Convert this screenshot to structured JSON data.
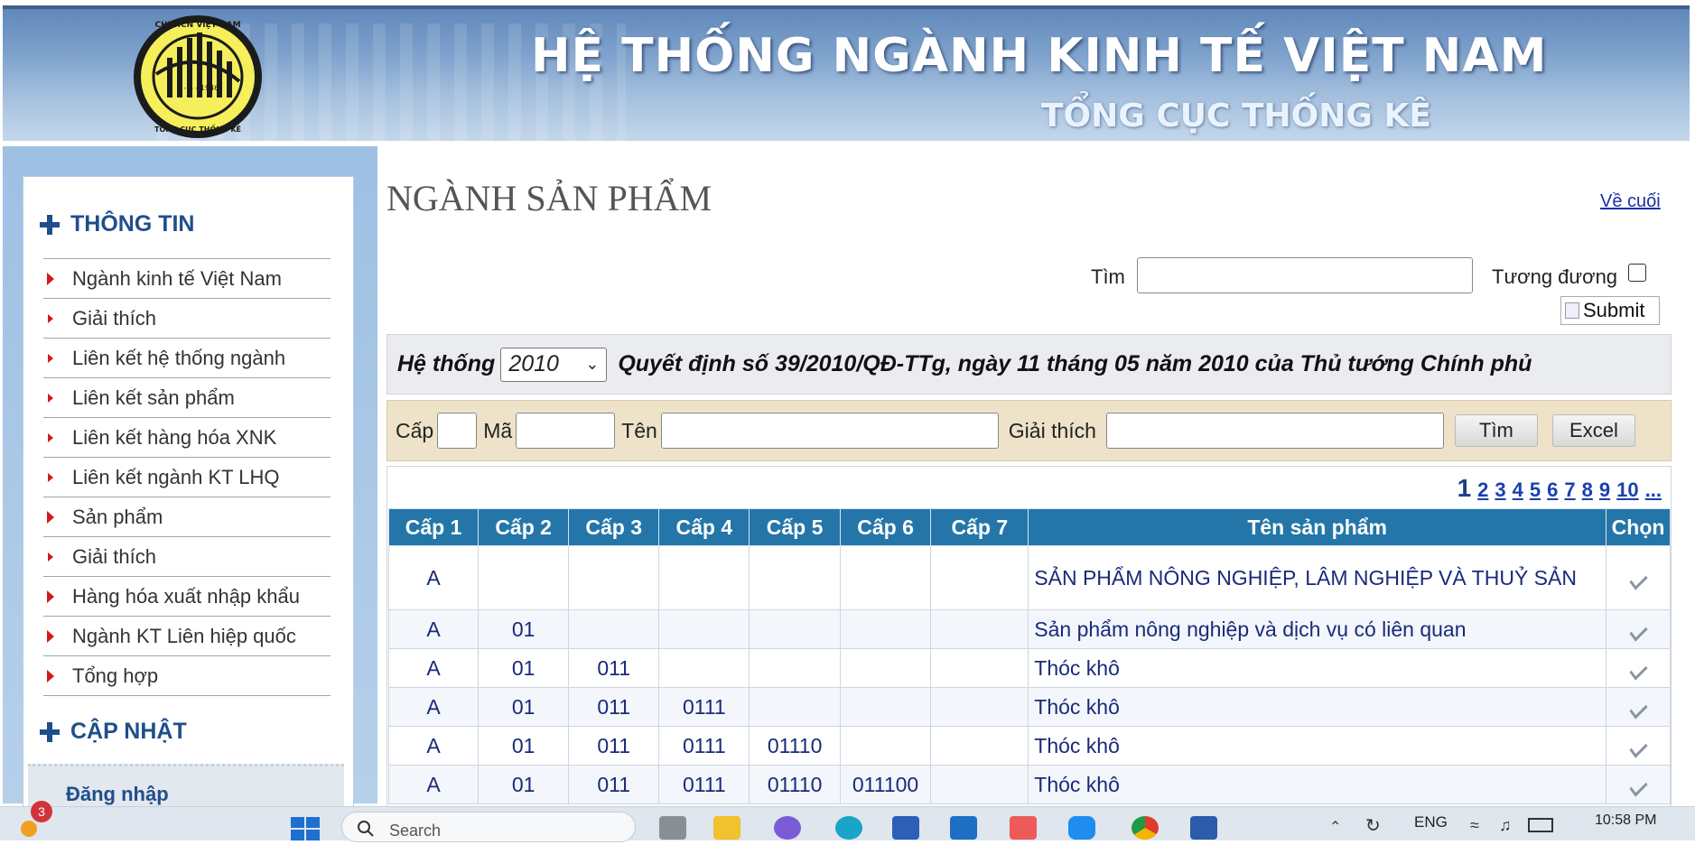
{
  "banner": {
    "title": "HỆ THỐNG NGÀNH KINH TẾ VIỆT NAM",
    "subtitle": "TỔNG CỤC THỐNG KÊ",
    "logo_top_text": "CHXHCN VIỆT NAM",
    "logo_date": "6 - 5 - 1946",
    "logo_bottom_text": "TỔNG CỤC THỐNG KÊ"
  },
  "sidebar": {
    "info_heading": "THÔNG TIN",
    "items": [
      {
        "label": "Ngành kinh tế Việt Nam",
        "arrow": "large"
      },
      {
        "label": "Giải thích",
        "arrow": "small"
      },
      {
        "label": "Liên kết hệ thống ngành",
        "arrow": "small"
      },
      {
        "label": "Liên kết sản phẩm",
        "arrow": "small"
      },
      {
        "label": "Liên kết hàng hóa XNK",
        "arrow": "small"
      },
      {
        "label": "Liên kết ngành KT LHQ",
        "arrow": "small"
      },
      {
        "label": "Sản phẩm",
        "arrow": "large"
      },
      {
        "label": "Giải thích",
        "arrow": "small"
      },
      {
        "label": "Hàng hóa xuất nhập khẩu",
        "arrow": "large"
      },
      {
        "label": "Ngành KT Liên hiệp quốc",
        "arrow": "large"
      },
      {
        "label": "Tổng hợp",
        "arrow": "large"
      }
    ],
    "update_heading": "CẬP NHẬT",
    "login_label": "Đăng nhập"
  },
  "main": {
    "page_title": "NGÀNH SẢN PHẨM",
    "to_end_link": "Về cuối",
    "search_label": "Tìm",
    "search_value": "",
    "equivalent_label": "Tương đương",
    "equivalent_checked": false,
    "submit_label": "Submit",
    "system_label": "Hệ thống",
    "system_selected": "2010",
    "decision_text": "Quyết định số 39/2010/QĐ-TTg, ngày 11 tháng 05 năm 2010 của Thủ tướng Chính phủ",
    "filter": {
      "level_label": "Cấp",
      "code_label": "Mã",
      "name_label": "Tên",
      "explain_label": "Giải thích",
      "find_button": "Tìm",
      "excel_button": "Excel"
    },
    "pager": {
      "current": "1",
      "pages": [
        "2",
        "3",
        "4",
        "5",
        "6",
        "7",
        "8",
        "9",
        "10",
        "..."
      ]
    },
    "table": {
      "headers": [
        "Cấp 1",
        "Cấp 2",
        "Cấp 3",
        "Cấp 4",
        "Cấp 5",
        "Cấp 6",
        "Cấp 7",
        "Tên sản phẩm",
        "Chọn"
      ],
      "rows": [
        {
          "c1": "A",
          "c2": "",
          "c3": "",
          "c4": "",
          "c5": "",
          "c6": "",
          "c7": "",
          "name": "SẢN PHẨM NÔNG NGHIỆP, LÂM NGHIỆP VÀ THUỶ SẢN"
        },
        {
          "c1": "A",
          "c2": "01",
          "c3": "",
          "c4": "",
          "c5": "",
          "c6": "",
          "c7": "",
          "name": "Sản phẩm nông nghiệp và dịch vụ có liên quan"
        },
        {
          "c1": "A",
          "c2": "01",
          "c3": "011",
          "c4": "",
          "c5": "",
          "c6": "",
          "c7": "",
          "name": "Thóc khô"
        },
        {
          "c1": "A",
          "c2": "01",
          "c3": "011",
          "c4": "0111",
          "c5": "",
          "c6": "",
          "c7": "",
          "name": "Thóc khô"
        },
        {
          "c1": "A",
          "c2": "01",
          "c3": "011",
          "c4": "0111",
          "c5": "01110",
          "c6": "",
          "c7": "",
          "name": "Thóc khô"
        },
        {
          "c1": "A",
          "c2": "01",
          "c3": "011",
          "c4": "0111",
          "c5": "01110",
          "c6": "011100",
          "c7": "",
          "name": "Thóc khô"
        }
      ]
    }
  },
  "taskbar": {
    "notification_count": "3",
    "search_placeholder": "Search",
    "language": "ENG",
    "time": "10:58 PM"
  },
  "colors": {
    "table_header": "#2476a8",
    "accent_blue": "#1f4e8c",
    "menu_arrow": "#d11a1a",
    "filter_bar": "#eee2c9"
  }
}
